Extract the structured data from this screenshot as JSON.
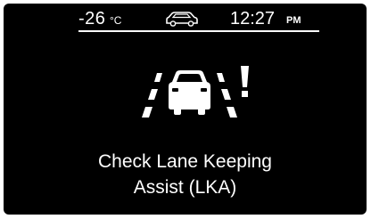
{
  "status_bar": {
    "temperature": "-26",
    "temperature_unit": "°C",
    "vehicle_icon": "car-outline-icon",
    "time": "12:27",
    "meridiem": "PM"
  },
  "warning": {
    "icon": "lane-keeping-assist-warning-icon",
    "line1": "Check Lane Keeping",
    "line2": "Assist (LKA)"
  },
  "colors": {
    "background": "#000000",
    "foreground": "#ffffff"
  }
}
